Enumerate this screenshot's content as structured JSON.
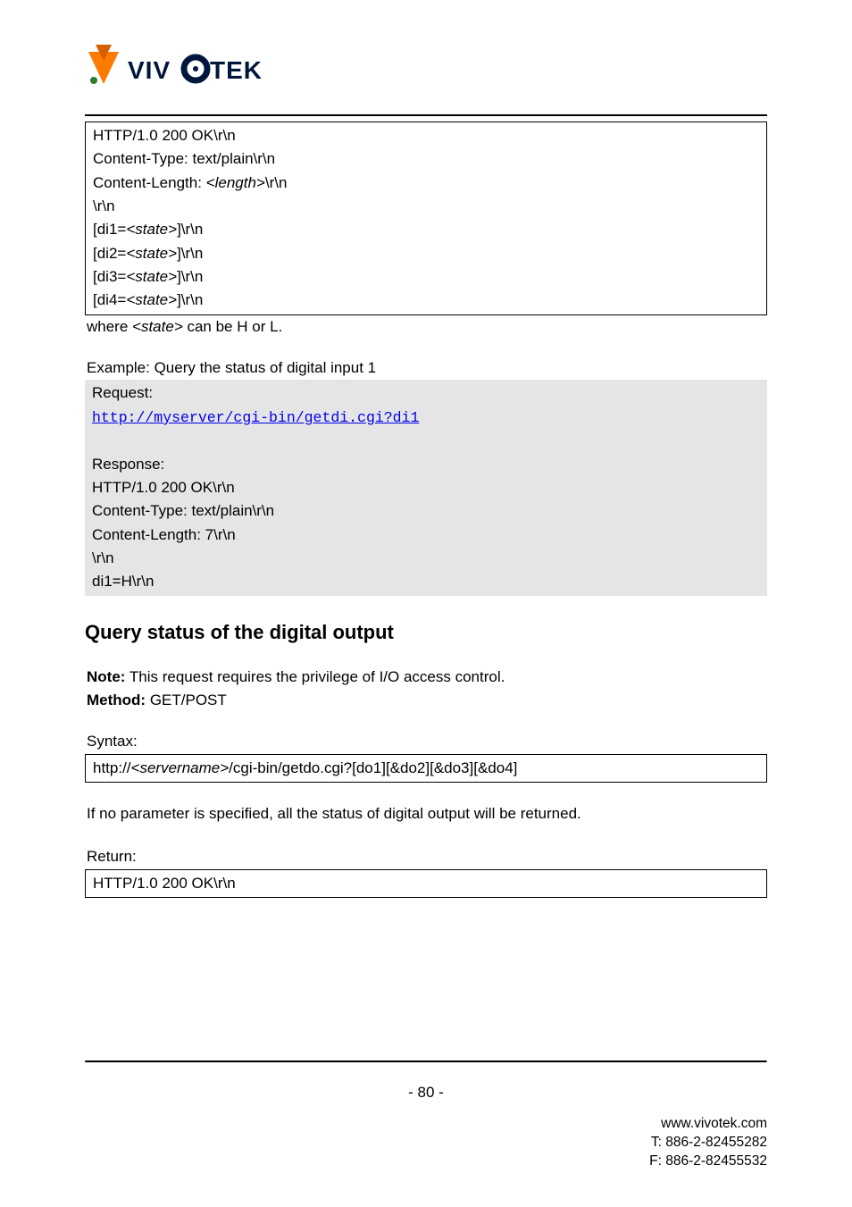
{
  "logo": {
    "brand": "VIVOTEK"
  },
  "block1": {
    "l1": "HTTP/1.0 200 OK\\r\\n",
    "l2": "Content-Type: text/plain\\r\\n",
    "l3_pre": "Content-Length: ",
    "l3_em": "<length>",
    "l3_post": "\\r\\n",
    "l4": "\\r\\n",
    "l5_pre": "[di1=",
    "l5_em": "<state>",
    "l5_post": "]\\r\\n",
    "l6_pre": "[di2=",
    "l6_em": "<state>",
    "l6_post": "]\\r\\n",
    "l7_pre": "[di3=",
    "l7_em": "<state>",
    "l7_post": "]\\r\\n",
    "l8_pre": "[di4=",
    "l8_em": "<state>",
    "l8_post": "]\\r\\n"
  },
  "where_pre": "where ",
  "where_em": "<state>",
  "where_post": " can be H or L.",
  "example_caption": "Example: Query the status of digital input 1",
  "shaded": {
    "request_label": "Request:",
    "url_text": "http://myserver/cgi-bin/getdi.cgi?di1",
    "url_href": "http://myserver/cgi-bin/getdi.cgi?di1",
    "response_label": "Response:",
    "r1": "HTTP/1.0 200 OK\\r\\n",
    "r2": "Content-Type: text/plain\\r\\n",
    "r3": "Content-Length: 7\\r\\n",
    "r4": "\\r\\n",
    "r5": "di1=H\\r\\n"
  },
  "section_title": "Query status of the digital output",
  "note": {
    "note_label": "Note:",
    "note_text": " This request requires the privilege of I/O access control.",
    "method_label": "Method:",
    "method_text": " GET/POST"
  },
  "syntax_label": "Syntax:",
  "syntax_box_pre": "http://",
  "syntax_box_em": "<servername>",
  "syntax_box_post": "/cgi-bin/getdo.cgi?[do1][&do2][&do3][&do4]",
  "after_syntax": "If no parameter is specified, all the status of digital output will be returned.",
  "return_label": "Return:",
  "return_box": "HTTP/1.0 200 OK\\r\\n",
  "page_number": "- 80 -",
  "footer": {
    "site": "www.vivotek.com",
    "tel": "T: 886-2-82455282",
    "fax": "F: 886-2-82455532"
  }
}
